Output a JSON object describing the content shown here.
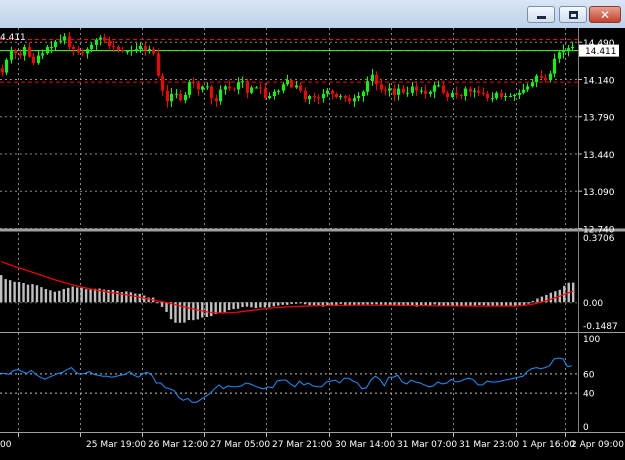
{
  "window": {
    "minimize_glyph": "",
    "maximize_glyph": "",
    "close_glyph": "✕"
  },
  "chart_data": [
    {
      "type": "candlestick",
      "panel": "price",
      "corner_label": "4.411",
      "ylim": [
        12.74,
        14.6
      ],
      "y_ticks": [
        "14.490",
        "14.140",
        "13.790",
        "13.440",
        "13.090",
        "12.740"
      ],
      "current_price_label": "14.411",
      "current_price": 14.411,
      "levels": [
        14.515,
        14.41,
        14.115
      ],
      "colors": {
        "bull": "#00ff00",
        "bear": "#ff0000",
        "levels": "#ff0000",
        "current": "#40ff40"
      },
      "closes": [
        14.2,
        14.32,
        14.41,
        14.38,
        14.36,
        14.44,
        14.35,
        14.29,
        14.36,
        14.38,
        14.44,
        14.44,
        14.49,
        14.5,
        14.54,
        14.44,
        14.42,
        14.39,
        14.38,
        14.42,
        14.46,
        14.51,
        14.53,
        14.5,
        14.45,
        14.44,
        14.41,
        14.4,
        14.4,
        14.41,
        14.42,
        14.45,
        14.41,
        14.42,
        14.38,
        14.17,
        14.03,
        13.93,
        14.0,
        14.0,
        13.94,
        13.99,
        14.11,
        14.1,
        14.04,
        14.07,
        14.07,
        13.96,
        13.93,
        14.04,
        14.07,
        14.05,
        14.04,
        14.11,
        14.12,
        14.01,
        14.06,
        14.06,
        14.05,
        13.96,
        13.98,
        14.02,
        14.03,
        14.09,
        14.13,
        14.06,
        14.08,
        14.03,
        13.95,
        13.98,
        13.97,
        13.96,
        14.0,
        14.03,
        14.0,
        13.97,
        13.98,
        13.96,
        13.93,
        13.96,
        13.98,
        14.02,
        14.12,
        14.18,
        14.09,
        14.04,
        14.03,
        14.05,
        13.99,
        14.05,
        14.01,
        14.01,
        14.07,
        14.03,
        14.03,
        14.0,
        14.02,
        14.08,
        14.08,
        14.01,
        13.97,
        14.01,
        13.99,
        13.98,
        14.05,
        14.02,
        14.03,
        14.01,
        14.0,
        13.96,
        13.96,
        14.01,
        13.97,
        13.98,
        13.98,
        13.99,
        14.01,
        14.04,
        14.07,
        14.11,
        14.17,
        14.15,
        14.13,
        14.19,
        14.33,
        14.39,
        14.41,
        14.43,
        14.44
      ]
    },
    {
      "type": "histogram",
      "panel": "macd",
      "ylim": [
        -0.1487,
        0.3706
      ],
      "y_ticks": [
        "0.3706",
        "0.00",
        "-0.1487"
      ],
      "colors": {
        "bars": "#c0c0c0",
        "signal": "#ff0000"
      },
      "values": [
        0.145,
        0.124,
        0.118,
        0.109,
        0.108,
        0.103,
        0.094,
        0.097,
        0.091,
        0.081,
        0.071,
        0.064,
        0.056,
        0.061,
        0.071,
        0.077,
        0.084,
        0.079,
        0.078,
        0.07,
        0.069,
        0.072,
        0.073,
        0.068,
        0.066,
        0.066,
        0.06,
        0.054,
        0.058,
        0.053,
        0.046,
        0.045,
        0.036,
        0.025,
        0.025,
        -0.001,
        -0.025,
        -0.052,
        -0.091,
        -0.11,
        -0.11,
        -0.109,
        -0.095,
        -0.096,
        -0.092,
        -0.082,
        -0.079,
        -0.074,
        -0.063,
        -0.06,
        -0.054,
        -0.042,
        -0.037,
        -0.035,
        -0.026,
        -0.024,
        -0.027,
        -0.031,
        -0.028,
        -0.028,
        -0.027,
        -0.022,
        -0.018,
        -0.014,
        -0.014,
        -0.009,
        -0.008,
        -0.006,
        -0.011,
        -0.016,
        -0.016,
        -0.021,
        -0.024,
        -0.018,
        -0.016,
        -0.015,
        -0.009,
        -0.016,
        -0.018,
        -0.016,
        -0.014,
        -0.013,
        -0.013,
        -0.011,
        -0.011,
        -0.013,
        -0.016,
        -0.014,
        -0.015,
        -0.015,
        -0.019,
        -0.019,
        -0.02,
        -0.024,
        -0.019,
        -0.016,
        -0.018,
        -0.012,
        -0.017,
        -0.018,
        -0.018,
        -0.023,
        -0.022,
        -0.02,
        -0.022,
        -0.019,
        -0.021,
        -0.015,
        -0.016,
        -0.023,
        -0.02,
        -0.02,
        -0.023,
        -0.022,
        -0.02,
        -0.023,
        -0.016,
        -0.017,
        -0.008,
        0.007,
        0.02,
        0.03,
        0.039,
        0.051,
        0.059,
        0.066,
        0.088,
        0.104,
        0.105
      ],
      "signal": [
        0.217,
        0.209,
        0.2,
        0.192,
        0.184,
        0.176,
        0.168,
        0.16,
        0.152,
        0.144,
        0.136,
        0.128,
        0.12,
        0.113,
        0.106,
        0.099,
        0.093,
        0.087,
        0.081,
        0.076,
        0.071,
        0.066,
        0.062,
        0.058,
        0.054,
        0.05,
        0.047,
        0.043,
        0.039,
        0.035,
        0.031,
        0.027,
        0.022,
        0.017,
        0.012,
        0.007,
        0.003,
        -0.002,
        -0.007,
        -0.013,
        -0.019,
        -0.025,
        -0.031,
        -0.037,
        -0.042,
        -0.047,
        -0.051,
        -0.054,
        -0.056,
        -0.057,
        -0.057,
        -0.056,
        -0.055,
        -0.053,
        -0.05,
        -0.047,
        -0.044,
        -0.041,
        -0.038,
        -0.035,
        -0.032,
        -0.03,
        -0.028,
        -0.026,
        -0.025,
        -0.024,
        -0.023,
        -0.022,
        -0.021,
        -0.02,
        -0.019,
        -0.018,
        -0.018,
        -0.018,
        -0.017,
        -0.017,
        -0.017,
        -0.017,
        -0.016,
        -0.016,
        -0.016,
        -0.016,
        -0.016,
        -0.016,
        -0.016,
        -0.016,
        -0.016,
        -0.016,
        -0.017,
        -0.017,
        -0.017,
        -0.017,
        -0.018,
        -0.018,
        -0.018,
        -0.018,
        -0.019,
        -0.019,
        -0.019,
        -0.019,
        -0.019,
        -0.019,
        -0.02,
        -0.02,
        -0.02,
        -0.02,
        -0.02,
        -0.02,
        -0.02,
        -0.02,
        -0.02,
        -0.02,
        -0.02,
        -0.02,
        -0.02,
        -0.021,
        -0.019,
        -0.017,
        -0.014,
        -0.01,
        -0.005,
        0.001,
        0.008,
        0.016,
        0.024,
        0.032,
        0.042,
        0.051,
        0.06
      ]
    },
    {
      "type": "line",
      "panel": "oscillator",
      "ylim": [
        0,
        100
      ],
      "y_ticks": [
        "100",
        "60",
        "40",
        "0"
      ],
      "levels": [
        60,
        40
      ],
      "colors": {
        "line": "#1e90ff",
        "levels": "#c0c0c0"
      },
      "values": [
        60,
        60,
        59,
        63,
        64,
        62,
        60,
        63,
        59,
        56,
        54,
        56,
        58,
        60,
        61,
        64,
        66,
        61,
        59,
        60,
        62,
        59,
        58,
        57,
        57,
        56,
        57,
        58,
        59,
        62,
        58,
        56,
        60,
        61,
        58,
        50,
        50,
        45,
        44,
        42,
        35,
        32,
        34,
        30,
        30,
        33,
        36,
        39,
        44,
        48,
        44,
        47,
        46,
        46,
        47,
        50,
        49,
        47,
        45,
        44,
        46,
        45,
        52,
        53,
        53,
        49,
        46,
        52,
        48,
        50,
        47,
        46,
        46,
        51,
        52,
        53,
        50,
        55,
        55,
        52,
        50,
        44,
        45,
        53,
        57,
        54,
        47,
        56,
        56,
        58,
        51,
        49,
        53,
        51,
        50,
        48,
        46,
        47,
        51,
        49,
        50,
        54,
        51,
        52,
        54,
        55,
        53,
        48,
        48,
        52,
        51,
        51,
        52,
        53,
        54,
        55,
        56,
        57,
        62,
        65,
        66,
        65,
        66,
        68,
        75,
        76,
        75,
        67,
        68
      ],
      "x_tick_labels": [
        "00",
        "25 Mar 19:00",
        "26 Mar 12:00",
        "27 Mar 05:00",
        "27 Mar 21:00",
        "30 Mar 14:00",
        "31 Mar 07:00",
        "31 Mar 23:00",
        "1 Apr 16:00",
        "2 Apr 09:00"
      ]
    }
  ]
}
